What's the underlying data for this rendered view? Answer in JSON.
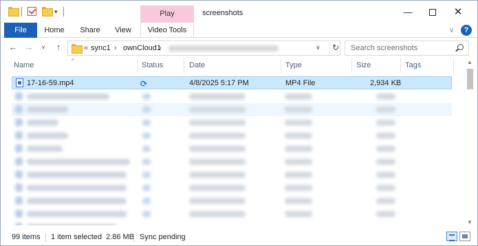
{
  "window": {
    "title": "screenshots",
    "context_tab": "Play",
    "controls": {
      "minimize": "—",
      "maximize": "",
      "close": "✕"
    }
  },
  "ribbon": {
    "tabs": [
      "File",
      "Home",
      "Share",
      "View",
      "Video Tools"
    ],
    "collapse_icon": "chevron-down-icon",
    "help": "?"
  },
  "navigation": {
    "back": "←",
    "forward": "→",
    "recent": "∨",
    "up": "↑",
    "breadcrumb_prefix": "«",
    "breadcrumb": [
      "sync1",
      "ownCloud1"
    ],
    "breadcrumb_separator": "›",
    "refresh": "↻",
    "dropdown": "∨"
  },
  "search": {
    "placeholder": "Search screenshots"
  },
  "columns": {
    "name": "Name",
    "status": "Status",
    "date": "Date",
    "type": "Type",
    "size": "Size",
    "tags": "Tags",
    "sort_indicator": "^"
  },
  "files": [
    {
      "name": "17-16-59.mp4",
      "status_icon": "sync-icon",
      "status": "⟳",
      "date": "4/8/2025 5:17 PM",
      "type": "MP4 File",
      "size": "2,934 KB",
      "selected": true
    }
  ],
  "status_bar": {
    "item_count": "99 items",
    "selection": "1 item selected  2.86 MB",
    "sync": "Sync pending"
  },
  "colors": {
    "accent": "#1a62b7",
    "context_tab": "#f8c9de",
    "selection": "#cce8ff"
  }
}
